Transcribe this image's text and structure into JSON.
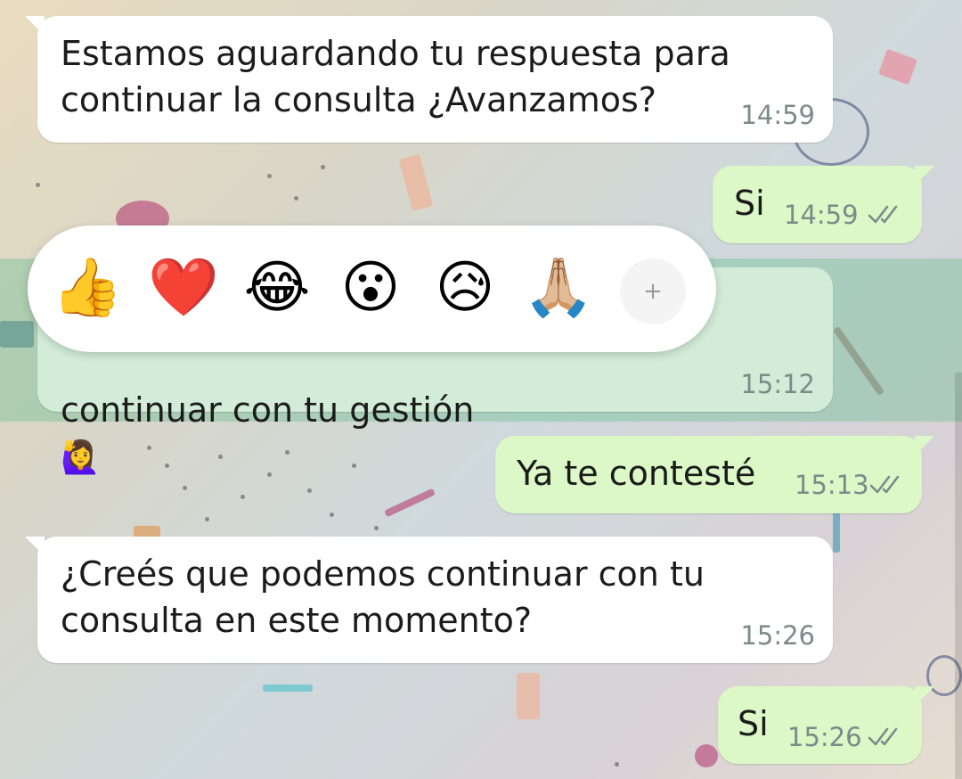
{
  "messages": [
    {
      "direction": "in",
      "text": "Estamos aguardando tu respuesta para\ncontinuar la consulta ¿Avanzamos?",
      "time": "14:59"
    },
    {
      "direction": "out",
      "text": "Si",
      "time": "14:59"
    },
    {
      "direction": "in",
      "text": "continuar con tu gestión",
      "emoji": "🙋‍♀️",
      "time": "15:12",
      "highlighted": true
    },
    {
      "direction": "out",
      "text": "Ya te contesté",
      "time": "15:13"
    },
    {
      "direction": "in",
      "text": "¿Creés que podemos continuar con tu\nconsulta en este momento?",
      "time": "15:26"
    },
    {
      "direction": "out",
      "text": "Si",
      "time": "15:26"
    }
  ],
  "reaction_bar": {
    "reactions": [
      {
        "emoji": "👍",
        "icon": "thumbs-up-icon"
      },
      {
        "emoji": "❤️",
        "icon": "heart-icon"
      },
      {
        "emoji": "😂",
        "icon": "tears-of-joy-icon"
      },
      {
        "emoji": "😮",
        "icon": "surprised-icon"
      },
      {
        "emoji": "😥",
        "icon": "sad-icon"
      },
      {
        "emoji": "🙏🏼",
        "icon": "praying-hands-icon"
      }
    ],
    "add_label": "+"
  },
  "colors": {
    "incoming_bubble": "#ffffff",
    "outgoing_bubble": "#dcf8c6",
    "highlight": "#6ebe96",
    "timestamp": "#7d8a8a",
    "read_ticks": "#7d8a8a"
  }
}
